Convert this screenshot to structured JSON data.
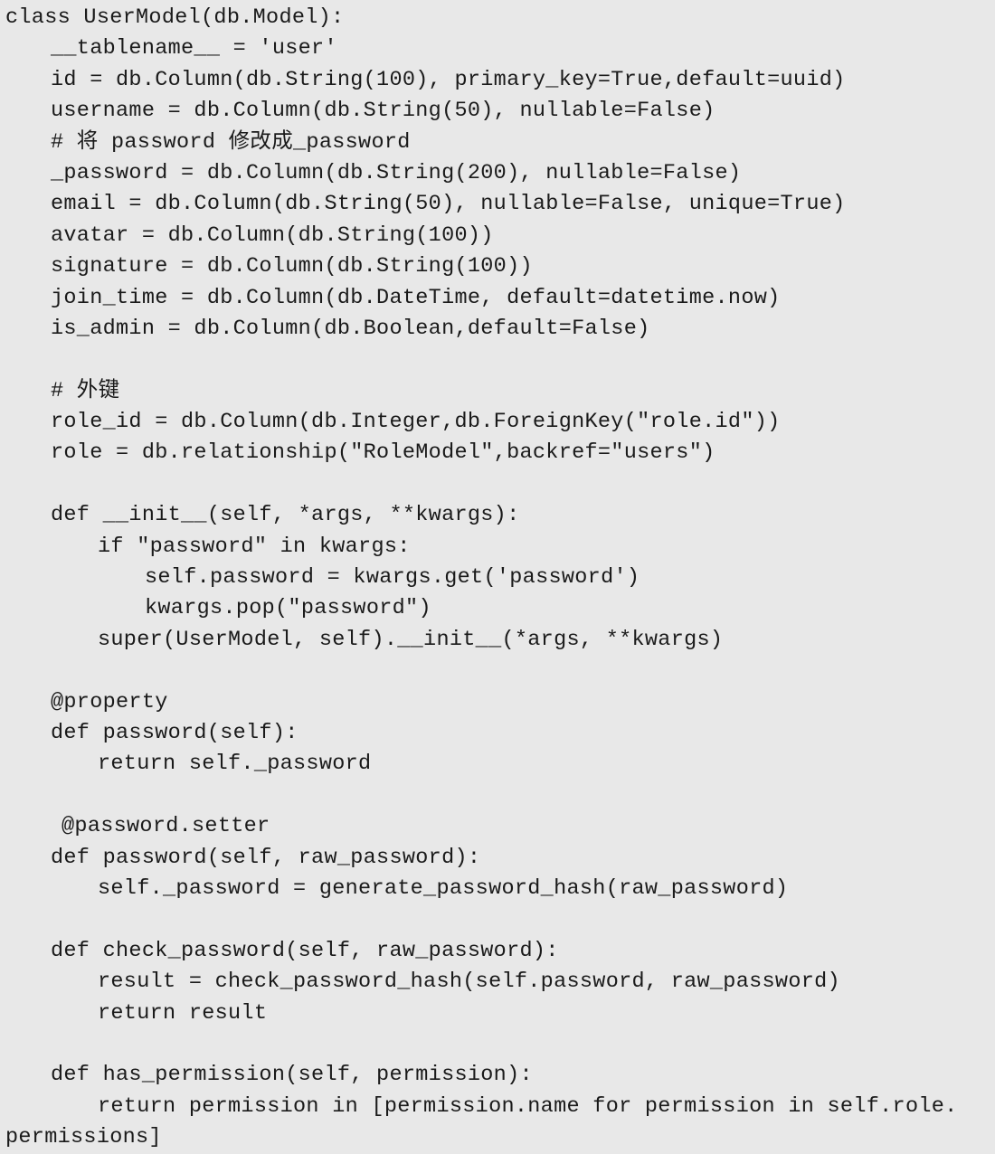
{
  "code": {
    "lines": [
      {
        "indent": 0,
        "text": "class UserModel(db.Model):"
      },
      {
        "indent": 1,
        "text": "__tablename__ = 'user'"
      },
      {
        "indent": 1,
        "text": "id = db.Column(db.String(100), primary_key=True,default=uuid)"
      },
      {
        "indent": 1,
        "text": "username = db.Column(db.String(50), nullable=False)"
      },
      {
        "indent": 1,
        "text": "# 将 password 修改成_password"
      },
      {
        "indent": 1,
        "text": "_password = db.Column(db.String(200), nullable=False)"
      },
      {
        "indent": 1,
        "text": "email = db.Column(db.String(50), nullable=False, unique=True)"
      },
      {
        "indent": 1,
        "text": "avatar = db.Column(db.String(100))"
      },
      {
        "indent": 1,
        "text": "signature = db.Column(db.String(100))"
      },
      {
        "indent": 1,
        "text": "join_time = db.Column(db.DateTime, default=datetime.now)"
      },
      {
        "indent": 1,
        "text": "is_admin = db.Column(db.Boolean,default=False)"
      },
      {
        "indent": 0,
        "text": ""
      },
      {
        "indent": 1,
        "text": "# 外键"
      },
      {
        "indent": 1,
        "text": "role_id = db.Column(db.Integer,db.ForeignKey(\"role.id\"))"
      },
      {
        "indent": 1,
        "text": "role = db.relationship(\"RoleModel\",backref=\"users\")"
      },
      {
        "indent": 0,
        "text": ""
      },
      {
        "indent": 1,
        "text": "def __init__(self, *args, **kwargs):"
      },
      {
        "indent": 2,
        "text": "if \"password\" in kwargs:"
      },
      {
        "indent": 3,
        "text": "self.password = kwargs.get('password')"
      },
      {
        "indent": 3,
        "text": "kwargs.pop(\"password\")"
      },
      {
        "indent": 2,
        "text": "super(UserModel, self).__init__(*args, **kwargs)"
      },
      {
        "indent": 0,
        "text": ""
      },
      {
        "indent": 1,
        "text": "@property"
      },
      {
        "indent": 1,
        "text": "def password(self):"
      },
      {
        "indent": 2,
        "text": "return self._password"
      },
      {
        "indent": 0,
        "text": ""
      },
      {
        "indent": 1.2,
        "text": "@password.setter"
      },
      {
        "indent": 1,
        "text": "def password(self, raw_password):"
      },
      {
        "indent": 2,
        "text": "self._password = generate_password_hash(raw_password)"
      },
      {
        "indent": 0,
        "text": ""
      },
      {
        "indent": 1,
        "text": "def check_password(self, raw_password):"
      },
      {
        "indent": 2,
        "text": "result = check_password_hash(self.password, raw_password)"
      },
      {
        "indent": 2,
        "text": "return result"
      },
      {
        "indent": 0,
        "text": ""
      },
      {
        "indent": 1,
        "text": "def has_permission(self, permission):"
      },
      {
        "indent": 2,
        "text": "return permission in [permission.name for permission in self.role."
      },
      {
        "indent": 0,
        "text": "permissions]"
      }
    ]
  }
}
